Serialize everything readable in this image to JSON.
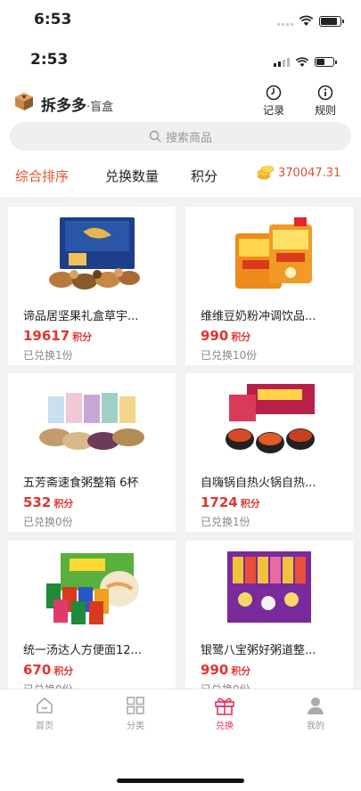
{
  "status_outer": {
    "time": "6:53"
  },
  "status_inner": {
    "time": "2:53"
  },
  "header": {
    "brand": "拆多多",
    "brand_sub": "·盲盒",
    "records": "记录",
    "rules": "规则"
  },
  "search": {
    "placeholder": "搜索商品"
  },
  "sort": {
    "comprehensive": "综合排序",
    "quantity": "兑换数量",
    "points": "积分"
  },
  "balance": "370047.31",
  "points_unit": "积分",
  "products": [
    {
      "name": "谛品居坚果礼盒草宇...",
      "points": "19617",
      "sold": "已兑换1份",
      "img": "nuts-gift-box"
    },
    {
      "name": "维维豆奶粉冲调饮品...",
      "points": "990",
      "sold": "已兑换10份",
      "img": "soy-milk-powder"
    },
    {
      "name": "五芳斋速食粥整箱 6杯",
      "points": "532",
      "sold": "已兑换0份",
      "img": "porridge-cups"
    },
    {
      "name": "自嗨锅自热火锅自热...",
      "points": "1724",
      "sold": "已兑换1份",
      "img": "self-heating-hotpot"
    },
    {
      "name": "统一汤达人方便面12...",
      "points": "670",
      "sold": "已兑换0份",
      "img": "instant-noodles"
    },
    {
      "name": "银鹭八宝粥好粥道整...",
      "points": "990",
      "sold": "已兑换0份",
      "img": "eight-treasure-porridge"
    }
  ],
  "tabs": [
    {
      "label": "首页",
      "icon": "home-icon"
    },
    {
      "label": "分类",
      "icon": "grid-icon"
    },
    {
      "label": "兑换",
      "icon": "gift-icon"
    },
    {
      "label": "我的",
      "icon": "user-icon"
    }
  ],
  "colors": {
    "accent": "#e0552f",
    "price": "#e0352f",
    "tab_active": "#e0355a"
  }
}
